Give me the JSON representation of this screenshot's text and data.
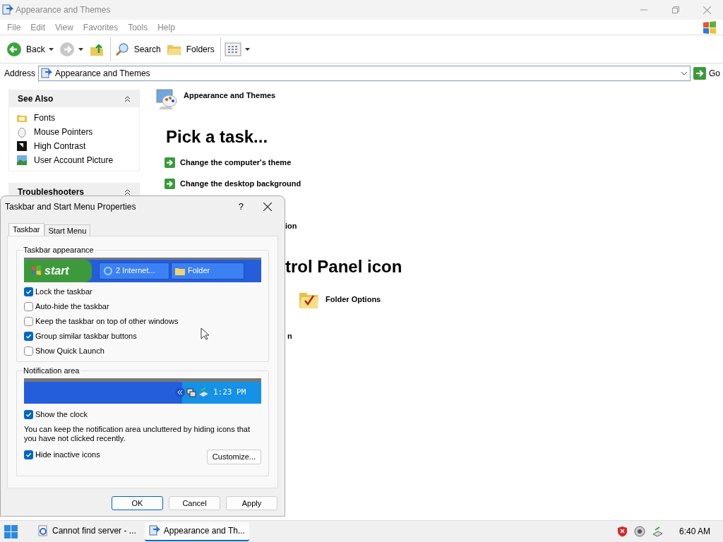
{
  "window": {
    "title": "Appearance and Themes"
  },
  "menu": [
    "File",
    "Edit",
    "View",
    "Favorites",
    "Tools",
    "Help"
  ],
  "toolbar": [
    {
      "kind": "back",
      "label": "Back"
    },
    {
      "kind": "forward"
    },
    {
      "kind": "up"
    },
    {
      "kind": "search",
      "label": "Search"
    },
    {
      "kind": "folders",
      "label": "Folders"
    },
    {
      "kind": "views"
    }
  ],
  "address": {
    "label": "Address",
    "value": "Appearance and Themes",
    "go": "Go"
  },
  "sidebar": [
    {
      "title": "See Also",
      "items": [
        {
          "kind": "fonts",
          "label": "Fonts"
        },
        {
          "kind": "mouse",
          "label": "Mouse Pointers"
        },
        {
          "kind": "contrast",
          "label": "High Contrast"
        },
        {
          "kind": "picture",
          "label": "User Account Picture"
        }
      ]
    },
    {
      "title": "Troubleshooters"
    }
  ],
  "content": {
    "header": "Appearance and Themes",
    "heading": "Pick a task...",
    "tasks": [
      {
        "kind": "full",
        "text": "Change the computer's theme"
      },
      {
        "kind": "full",
        "text": "Change the desktop background"
      },
      {
        "kind": "partial",
        "text": "ion"
      }
    ],
    "heading_2": "trol Panel icon",
    "icons": [
      {
        "label": "Folder Options"
      }
    ],
    "fragment": "n"
  },
  "dialog": {
    "title": "Taskbar and Start Menu Properties",
    "help": "?",
    "tabs": [
      {
        "label": "Taskbar",
        "selected": true
      },
      {
        "label": "Start Menu",
        "selected": false
      }
    ],
    "appearance": {
      "title": "Taskbar appearance",
      "start": "start",
      "buttons": [
        "2 Internet...",
        "Folder"
      ],
      "options": [
        {
          "label": "Lock the taskbar",
          "checked": true
        },
        {
          "label": "Auto-hide the taskbar",
          "checked": false
        },
        {
          "label": "Keep the taskbar on top of other windows",
          "checked": false
        },
        {
          "label": "Group similar taskbar buttons",
          "checked": true
        },
        {
          "label": "Show Quick Launch",
          "checked": false
        }
      ]
    },
    "notification": {
      "title": "Notification area",
      "clock": "1:23 PM",
      "show_clock": {
        "label": "Show the clock",
        "checked": true
      },
      "note": "You can keep the notification area uncluttered by hiding icons that you have not clicked recently.",
      "hide_inactive": {
        "label": "Hide inactive icons",
        "checked": true
      },
      "customize": "Customize..."
    },
    "buttons": [
      {
        "label": "OK",
        "default": true
      },
      {
        "label": "Cancel",
        "default": false
      },
      {
        "label": "Apply",
        "default": false
      }
    ]
  },
  "taskbar": {
    "items": [
      {
        "kind": "ie",
        "label": "Cannot find server - ...",
        "selected": false
      },
      {
        "kind": "cp",
        "label": "Appearance and Th...",
        "selected": true
      }
    ],
    "clock": "6:40 AM"
  }
}
